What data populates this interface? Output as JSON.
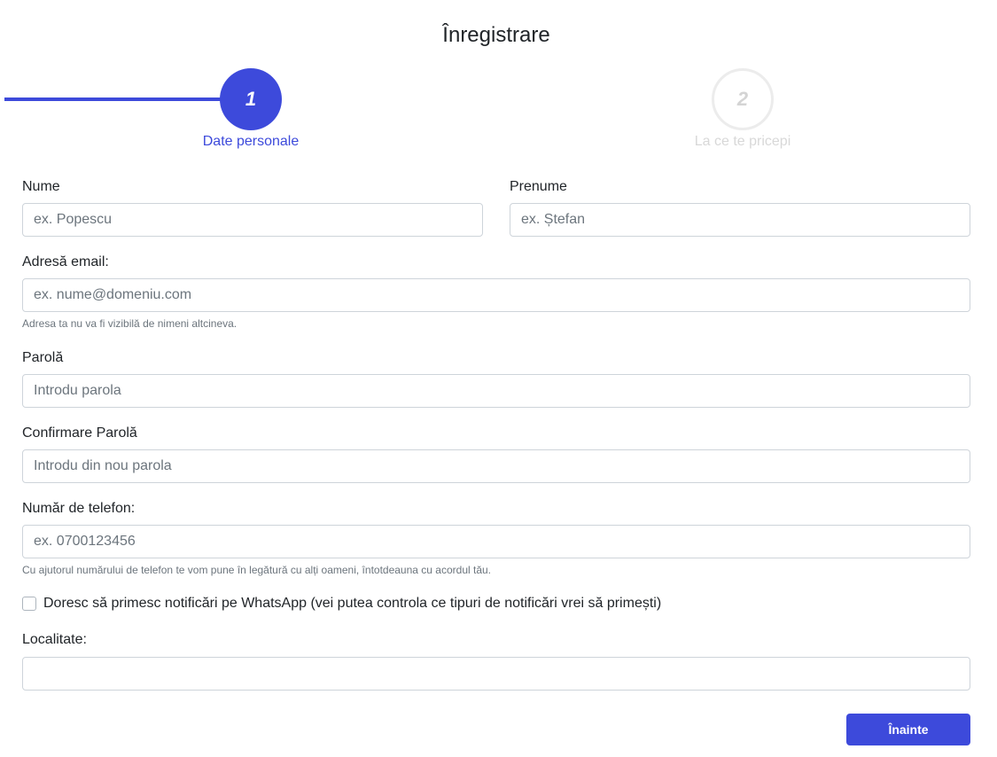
{
  "page": {
    "title": "Înregistrare"
  },
  "stepper": {
    "active_color": "#3d4adb",
    "inactive_color": "#d4d4d4",
    "steps": [
      {
        "number": "1",
        "label": "Date personale",
        "state": "active"
      },
      {
        "number": "2",
        "label": "La ce te pricepi",
        "state": "inactive"
      }
    ]
  },
  "form": {
    "last_name": {
      "label": "Nume",
      "placeholder": "ex. Popescu",
      "value": ""
    },
    "first_name": {
      "label": "Prenume",
      "placeholder": "ex. Ștefan",
      "value": ""
    },
    "email": {
      "label": "Adresă email:",
      "placeholder": "ex. nume@domeniu.com",
      "value": "",
      "help": "Adresa ta nu va fi vizibilă de nimeni altcineva."
    },
    "password": {
      "label": "Parolă",
      "placeholder": "Introdu parola",
      "value": ""
    },
    "password_confirm": {
      "label": "Confirmare Parolă",
      "placeholder": "Introdu din nou parola",
      "value": ""
    },
    "phone": {
      "label": "Număr de telefon:",
      "placeholder": "ex. 0700123456",
      "value": "",
      "help": "Cu ajutorul numărului de telefon te vom pune în legătură cu alți oameni, întotdeauna cu acordul tău."
    },
    "whatsapp": {
      "label": "Doresc să primesc notificări pe WhatsApp (vei putea controla ce tipuri de notificări vrei să primești)",
      "checked": false
    },
    "locality": {
      "label": "Localitate:",
      "placeholder": "",
      "value": ""
    }
  },
  "actions": {
    "next_label": "Înainte",
    "accent": "#3d4adb"
  }
}
